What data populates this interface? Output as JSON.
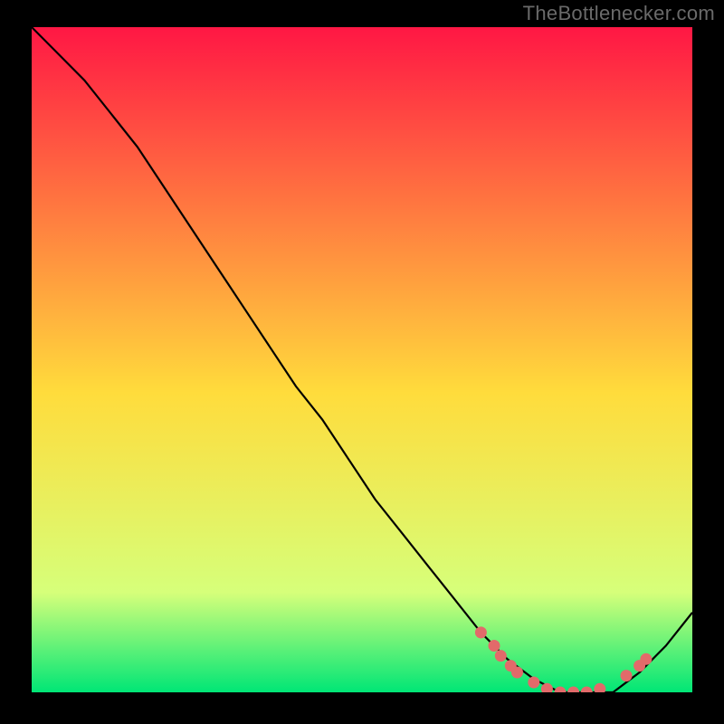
{
  "attribution": "TheBottlenecker.com",
  "colors": {
    "gradient_top": "#ff1744",
    "gradient_mid": "#ffdc3c",
    "gradient_green_start": "#d6ff7a",
    "gradient_bottom": "#00e676",
    "curve": "#000000",
    "markers": "#e26a6a",
    "bg": "#000000"
  },
  "chart_data": {
    "type": "line",
    "title": "",
    "xlabel": "",
    "ylabel": "",
    "xlim": [
      0,
      100
    ],
    "ylim": [
      0,
      100
    ],
    "series": [
      {
        "name": "curve",
        "x": [
          0,
          4,
          8,
          12,
          16,
          20,
          24,
          28,
          32,
          36,
          40,
          44,
          48,
          52,
          56,
          60,
          64,
          68,
          72,
          76,
          80,
          84,
          88,
          92,
          96,
          100
        ],
        "y": [
          100,
          96,
          92,
          87,
          82,
          76,
          70,
          64,
          58,
          52,
          46,
          41,
          35,
          29,
          24,
          19,
          14,
          9,
          5,
          2,
          0,
          0,
          0,
          3,
          7,
          12
        ]
      }
    ],
    "markers": {
      "name": "highlight-cluster",
      "points": [
        {
          "x": 68,
          "y": 9
        },
        {
          "x": 70,
          "y": 7
        },
        {
          "x": 71,
          "y": 5.5
        },
        {
          "x": 72.5,
          "y": 4
        },
        {
          "x": 73.5,
          "y": 3
        },
        {
          "x": 76,
          "y": 1.5
        },
        {
          "x": 78,
          "y": 0.5
        },
        {
          "x": 80,
          "y": 0
        },
        {
          "x": 82,
          "y": 0
        },
        {
          "x": 84,
          "y": 0
        },
        {
          "x": 86,
          "y": 0.5
        },
        {
          "x": 90,
          "y": 2.5
        },
        {
          "x": 92,
          "y": 4
        },
        {
          "x": 93,
          "y": 5
        }
      ]
    }
  }
}
